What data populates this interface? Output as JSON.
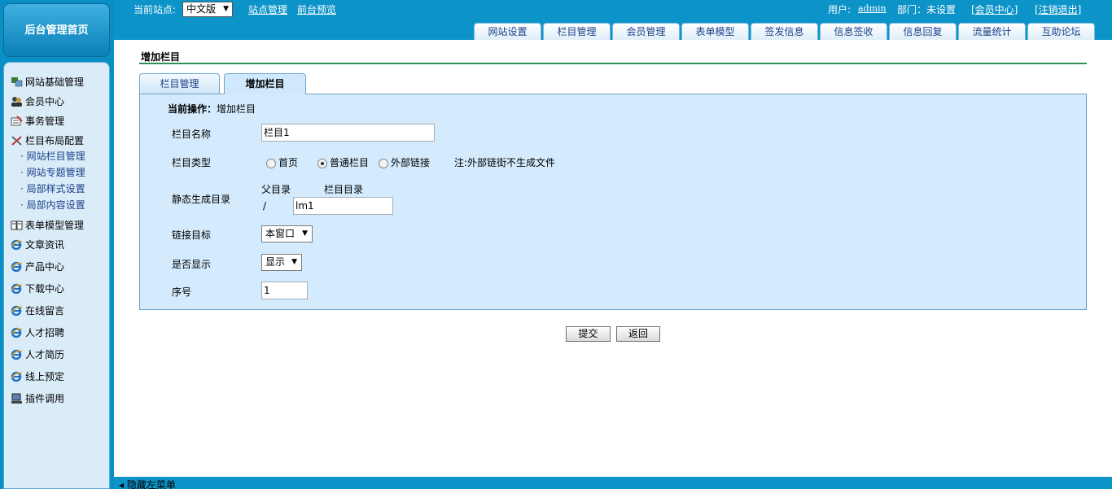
{
  "left": {
    "home_label": "后台管理首页",
    "menu": [
      {
        "label": "网站基础管理",
        "icon": "tree-icon"
      },
      {
        "label": "会员中心",
        "icon": "members-icon"
      },
      {
        "label": "事务管理",
        "icon": "affairs-icon"
      },
      {
        "label": "栏目布局配置",
        "icon": "tools-icon"
      }
    ],
    "submenu": [
      "· 网站栏目管理",
      "· 网站专题管理",
      "· 局部样式设置",
      "· 局部内容设置"
    ],
    "menu2": [
      {
        "label": "表单模型管理",
        "icon": "forms-icon"
      },
      {
        "label": "文章资讯",
        "icon": "ie-icon"
      },
      {
        "label": "产品中心",
        "icon": "ie-icon"
      },
      {
        "label": "下载中心",
        "icon": "ie-icon"
      },
      {
        "label": "在线留言",
        "icon": "ie-icon"
      },
      {
        "label": "人才招聘",
        "icon": "ie-icon"
      },
      {
        "label": "人才简历",
        "icon": "ie-icon"
      },
      {
        "label": "线上预定",
        "icon": "ie-icon"
      },
      {
        "label": "插件调用",
        "icon": "computer-icon"
      }
    ]
  },
  "top": {
    "site_label": "当前站点:",
    "site_value": "中文版",
    "site_mgmt": "站点管理",
    "preview": "前台预览",
    "user_label": "用户:",
    "user_name": "admin",
    "dept": "部门：未设置",
    "member_center": "[会员中心]",
    "logout": "[注销退出]",
    "tabs": [
      "网站设置",
      "栏目管理",
      "会员管理",
      "表单模型",
      "签发信息",
      "信息签收",
      "信息回复",
      "流量统计",
      "互助论坛"
    ]
  },
  "main": {
    "page_title": "增加栏目",
    "tabs": [
      "栏目管理",
      "增加栏目"
    ],
    "current_op_label": "当前操作：",
    "current_op_value": "增加栏目",
    "fields": {
      "name_label": "栏目名称",
      "name_value": "栏目1",
      "type_label": "栏目类型",
      "type_options": [
        "首页",
        "普通栏目",
        "外部链接"
      ],
      "type_note": "注:外部链街不生成文件",
      "dir_label": "静态生成目录",
      "parent_dir_label": "父目录",
      "column_dir_label": "栏目目录",
      "parent_dir_value": "/",
      "column_dir_value": "lm1",
      "target_label": "链接目标",
      "target_value": "本窗口",
      "show_label": "是否显示",
      "show_value": "显示",
      "order_label": "序号",
      "order_value": "1"
    },
    "submit_label": "提交",
    "back_label": "返回"
  },
  "bottom": {
    "hide_menu": "◂ 隐藏左菜单"
  }
}
